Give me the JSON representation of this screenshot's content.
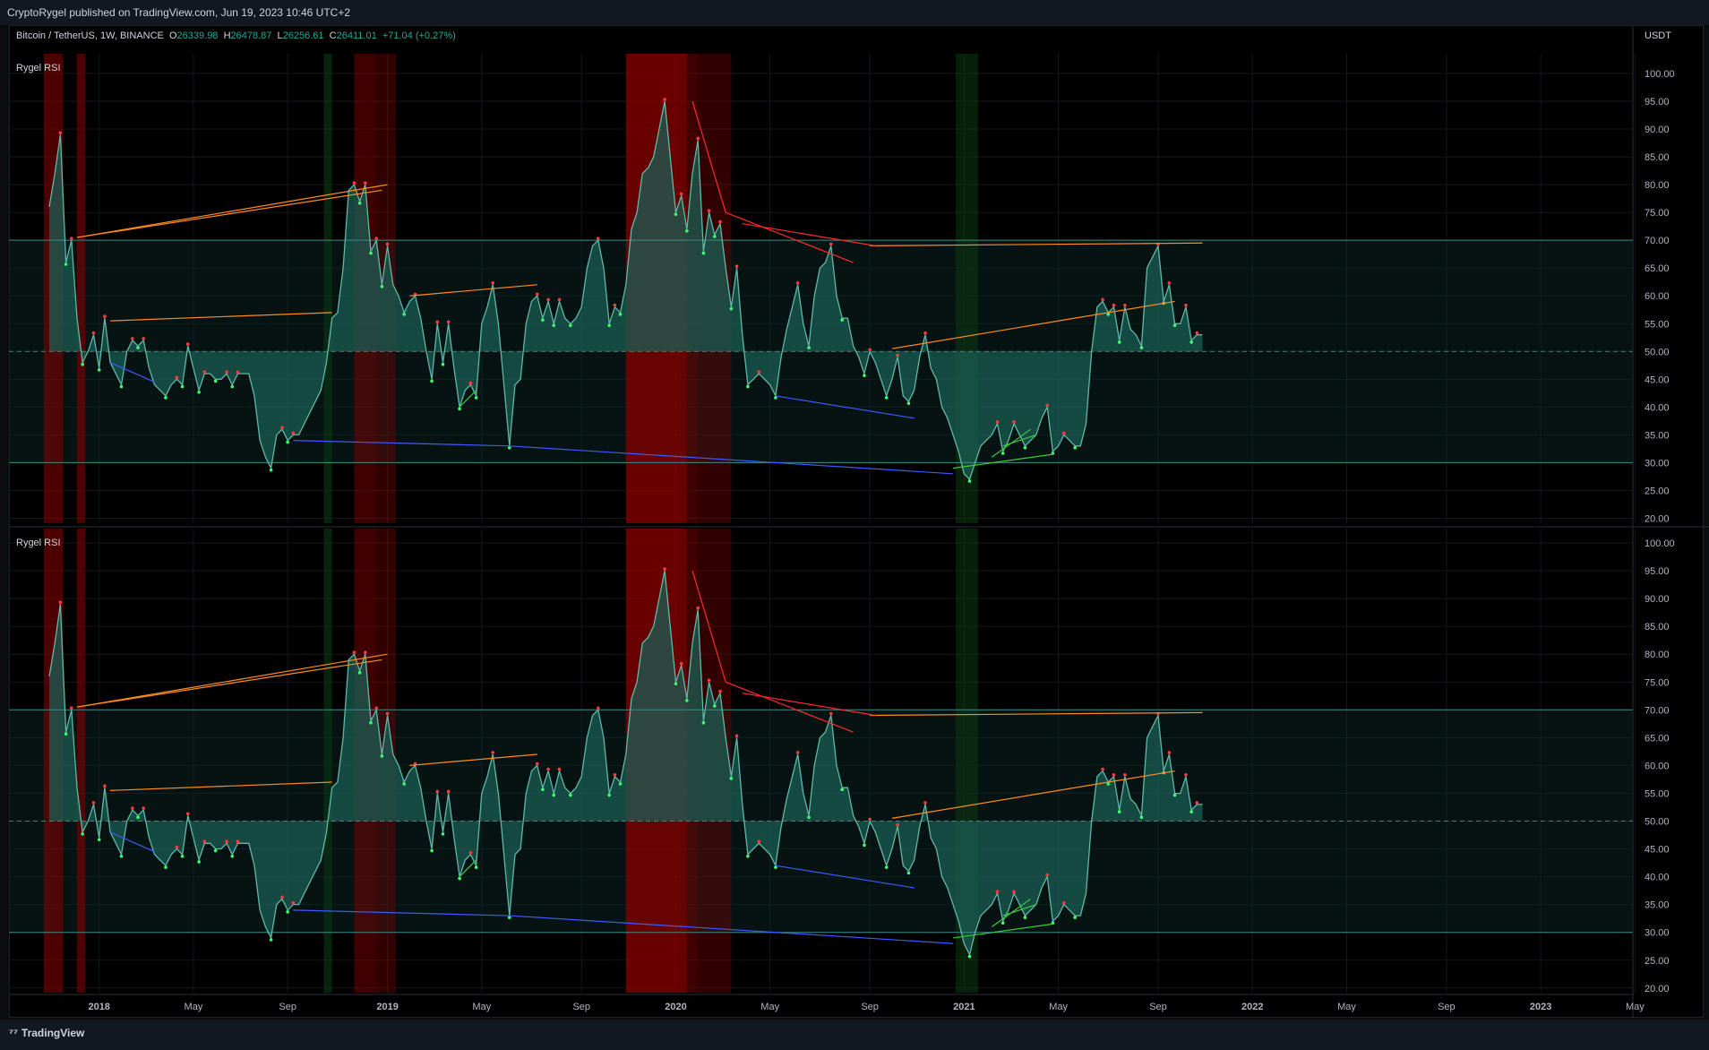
{
  "header": {
    "publisher_line": "CryptoRygel published on TradingView.com, Jun 19, 2023 10:46 UTC+2",
    "symbol": "Bitcoin / TetherUS, 1W, BINANCE",
    "o_label": "O",
    "o_value": "26339.98",
    "h_label": "H",
    "h_value": "26478.87",
    "l_label": "L",
    "l_value": "26256.61",
    "c_label": "C",
    "c_value": "26411.01",
    "change": "+71.04 (+0.27%)",
    "currency": "USDT"
  },
  "footer": {
    "brand": "TradingView"
  },
  "colors": {
    "fill": "#1b5e54",
    "line": "#5fb8a8",
    "overbought_zone": "#0e2b28",
    "red_zone": "#8b0000",
    "green_zone": "#0c3a12",
    "bull_div": "#3bcc3b",
    "bear_div": "#ff2a2a",
    "hidden_bear": "#ff8c1a",
    "hidden_bull": "#3c5aff"
  },
  "chart_data": [
    {
      "type": "area",
      "title": "Rygel RSI",
      "ylim": [
        20,
        100
      ],
      "y_ticks": [
        "100.00",
        "95.00",
        "90.00",
        "85.00",
        "80.00",
        "75.00",
        "70.00",
        "65.00",
        "60.00",
        "55.00",
        "50.00",
        "45.00",
        "40.00",
        "35.00",
        "30.00",
        "25.00",
        "20.00"
      ],
      "bands": {
        "upper": 70,
        "middle": 50,
        "lower": 30
      },
      "x_ticks": [
        "2018",
        "May",
        "Sep",
        "2019",
        "May",
        "Sep",
        "2020",
        "May",
        "Sep",
        "2021",
        "May",
        "Sep",
        "2022",
        "May",
        "Sep",
        "2023",
        "May"
      ],
      "x_start": "2017-10-30",
      "x_end": "2023-06-19",
      "series": [
        {
          "values": [
            76,
            82,
            89,
            66,
            70,
            56,
            48,
            50,
            53,
            47,
            56,
            48,
            46,
            44,
            50,
            52,
            51,
            52,
            47,
            44,
            43,
            42,
            44,
            45,
            44,
            51,
            47,
            43,
            46,
            46,
            45,
            45,
            46,
            44,
            46,
            46,
            46,
            42,
            34,
            31,
            29,
            35,
            36,
            34,
            35,
            35,
            37,
            39,
            41,
            43,
            48,
            56,
            57,
            65,
            79,
            80,
            77,
            80,
            68,
            70,
            62,
            69,
            62,
            60,
            57,
            59,
            60,
            56,
            50,
            45,
            55,
            48,
            55,
            47,
            40,
            43,
            44,
            42,
            55,
            58,
            62,
            55,
            44,
            33,
            44,
            45,
            55,
            59,
            60,
            56,
            59,
            55,
            59,
            56,
            55,
            56,
            58,
            65,
            69,
            70,
            65,
            55,
            58,
            57,
            62,
            72,
            75,
            82,
            83,
            85,
            90,
            95,
            85,
            75,
            78,
            72,
            82,
            88,
            68,
            75,
            71,
            73,
            65,
            58,
            65,
            53,
            44,
            45,
            46,
            45,
            44,
            42,
            49,
            54,
            58,
            62,
            55,
            51,
            60,
            65,
            66,
            69,
            60,
            56,
            56,
            51,
            49,
            46,
            50,
            48,
            45,
            42,
            45,
            49,
            42,
            41,
            43,
            49,
            53,
            47,
            45,
            40,
            38,
            35,
            32,
            28,
            27,
            30,
            33,
            34,
            35,
            37,
            32,
            34,
            37,
            35,
            33,
            34,
            35,
            38,
            40,
            32,
            33,
            35,
            34,
            33,
            33,
            37,
            50,
            58,
            59,
            57,
            58,
            52,
            58,
            54,
            53,
            51,
            65,
            67,
            69,
            59,
            62,
            55,
            55,
            58,
            52,
            53,
            53
          ]
        }
      ]
    },
    {
      "type": "area",
      "title": "Rygel RSI",
      "ylim": [
        20,
        100
      ],
      "y_ticks": [
        "100.00",
        "95.00",
        "90.00",
        "85.00",
        "80.00",
        "75.00",
        "70.00",
        "65.00",
        "60.00",
        "55.00",
        "50.00",
        "45.00",
        "40.00",
        "35.00",
        "30.00",
        "25.00",
        "20.00"
      ],
      "bands": {
        "upper": 70,
        "middle": 50,
        "lower": 30
      },
      "x_ticks": [
        "2018",
        "May",
        "Sep",
        "2019",
        "May",
        "Sep",
        "2020",
        "May",
        "Sep",
        "2021",
        "May",
        "Sep",
        "2022",
        "May",
        "Sep",
        "2023",
        "May"
      ],
      "x_start": "2017-10-30",
      "x_end": "2023-06-19",
      "series": [
        {
          "values": [
            76,
            82,
            89,
            66,
            70,
            56,
            48,
            50,
            53,
            47,
            56,
            48,
            46,
            44,
            50,
            52,
            51,
            52,
            47,
            44,
            43,
            42,
            44,
            45,
            44,
            51,
            47,
            43,
            46,
            46,
            45,
            45,
            46,
            44,
            46,
            46,
            46,
            42,
            34,
            31,
            29,
            35,
            36,
            34,
            35,
            35,
            37,
            39,
            41,
            43,
            48,
            56,
            57,
            65,
            79,
            80,
            77,
            80,
            68,
            70,
            62,
            69,
            62,
            60,
            57,
            59,
            60,
            56,
            50,
            45,
            55,
            48,
            55,
            47,
            40,
            43,
            44,
            42,
            55,
            58,
            62,
            55,
            44,
            33,
            44,
            45,
            55,
            59,
            60,
            56,
            59,
            55,
            59,
            56,
            55,
            56,
            58,
            65,
            69,
            70,
            65,
            55,
            58,
            57,
            62,
            72,
            75,
            82,
            83,
            85,
            90,
            95,
            85,
            75,
            78,
            72,
            82,
            88,
            68,
            75,
            71,
            73,
            65,
            58,
            65,
            53,
            44,
            45,
            46,
            45,
            44,
            42,
            49,
            54,
            58,
            62,
            55,
            51,
            60,
            65,
            66,
            69,
            60,
            56,
            56,
            51,
            49,
            46,
            50,
            48,
            45,
            42,
            45,
            49,
            42,
            41,
            43,
            49,
            53,
            47,
            45,
            40,
            38,
            35,
            32,
            28,
            26,
            30,
            33,
            34,
            35,
            37,
            32,
            34,
            37,
            35,
            33,
            34,
            35,
            38,
            40,
            32,
            33,
            35,
            34,
            33,
            33,
            37,
            50,
            58,
            59,
            57,
            58,
            52,
            58,
            54,
            53,
            51,
            65,
            67,
            69,
            59,
            62,
            55,
            55,
            58,
            52,
            53,
            53
          ]
        }
      ]
    }
  ]
}
